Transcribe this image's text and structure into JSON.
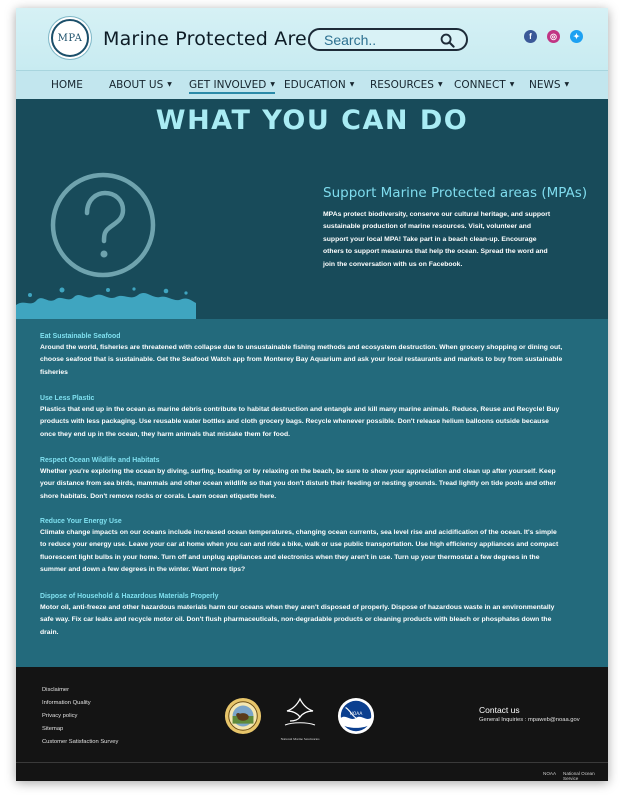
{
  "header": {
    "logo_text": "MPA",
    "site_title": "Marine Protected Areas",
    "search_placeholder": "Search..",
    "social": [
      {
        "name": "facebook-icon",
        "glyph": "f",
        "color": "#3b5998"
      },
      {
        "name": "instagram-icon",
        "glyph": "◎",
        "color": "#c13584"
      },
      {
        "name": "twitter-icon",
        "glyph": "✦",
        "color": "#1da1f2"
      }
    ]
  },
  "nav": {
    "items": [
      {
        "label": "HOME",
        "dropdown": false
      },
      {
        "label": "ABOUT US",
        "dropdown": true
      },
      {
        "label": "GET INVOLVED",
        "dropdown": true,
        "active": true
      },
      {
        "label": "EDUCATION",
        "dropdown": true
      },
      {
        "label": "RESOURCES",
        "dropdown": true
      },
      {
        "label": "CONNECT",
        "dropdown": true
      },
      {
        "label": "NEWS",
        "dropdown": true
      }
    ]
  },
  "hero": {
    "title": "WHAT YOU CAN DO",
    "subtitle": "Support Marine Protected areas (MPAs)",
    "text": "MPAs protect biodiversity, conserve our cultural heritage, and support sustainable production of marine resources. Visit, volunteer and support your local MPA! Take part in a beach clean-up. Encourage others to support measures that help the ocean. Spread the word and join the conversation with us on Facebook."
  },
  "tips": [
    {
      "heading": "Eat Sustainable Seafood",
      "body": "Around the world, fisheries are threatened with collapse due to unsustainable fishing methods and ecosystem destruction. When grocery shopping or dining out, choose seafood that is sustainable. Get the Seafood Watch app from Monterey Bay Aquarium and ask your local restaurants and markets to buy from sustainable fisheries"
    },
    {
      "heading": "Use Less Plastic",
      "body": "Plastics that end up in the ocean as marine debris contribute to habitat destruction and entangle and kill many marine animals. Reduce, Reuse and Recycle! Buy products with less packaging. Use reusable water bottles and cloth grocery bags. Recycle whenever possible. Don't release helium balloons outside because once they end up in the ocean, they harm animals that mistake them for food."
    },
    {
      "heading": "Respect Ocean Wildlife and Habitats",
      "body": "Whether you're exploring the ocean by diving, surfing, boating or by relaxing on the beach, be sure to show your appreciation and clean up after yourself. Keep your distance from sea birds, mammals and other ocean wildlife so that you don't disturb their feeding or nesting grounds. Tread lightly on tide pools and other shore habitats. Don't remove rocks or corals.  Learn ocean etiquette here."
    },
    {
      "heading": "Reduce Your Energy Use",
      "body": "Climate change impacts on our oceans include increased ocean temperatures, changing ocean currents, sea level rise and acidification of the ocean.  It's simple to reduce your energy use. Leave your car at home when you can and ride a bike, walk or use public transportation. Use high efficiency appliances and compact fluorescent light bulbs in your home. Turn off and unplug appliances and electronics when they aren't in use. Turn up your thermostat a few degrees in the summer and down a few degrees in the winter. Want more tips?"
    },
    {
      "heading": "Dispose of Household & Hazardous Materials Properly",
      "body": "Motor oil, anti-freeze and other hazardous materials harm our oceans when they aren't disposed of properly. Dispose of hazardous waste in an environmentally safe way. Fix car leaks and recycle motor oil.  Don't flush pharmaceuticals, non-degradable products or cleaning products with bleach or phosphates down the drain."
    }
  ],
  "footer": {
    "links": [
      "Disclaimer",
      "Information Quality",
      "Privacy policy",
      "Sitemap",
      "Customer Satisfaction Survey"
    ],
    "sanctuaries_label": "National Marine Sanctuaries",
    "noaa_label": "NOAA",
    "contact_title": "Contact us",
    "contact_line": "General Inquiries : mpaweb@noaa.gov",
    "bottom_left": "NOAA",
    "bottom_right": "National Ocean Service"
  }
}
